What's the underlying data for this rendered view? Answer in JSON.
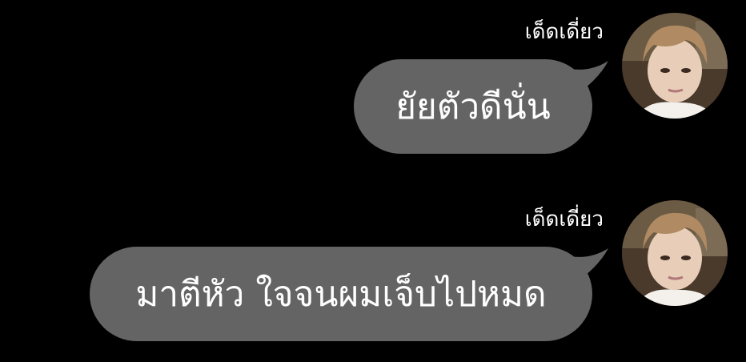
{
  "chat": {
    "messages": [
      {
        "sender": "เด็ดเดี่ยว",
        "text": "ยัยตัวดีนั่น",
        "avatar_icon": "user-avatar-photo"
      },
      {
        "sender": "เด็ดเดี่ยว",
        "text": "มาตีหัว ใจจนผมเจ็บไปหมด",
        "avatar_icon": "user-avatar-photo"
      }
    ]
  },
  "colors": {
    "background": "#000000",
    "bubble": "#646464",
    "text": "#ffffff"
  }
}
